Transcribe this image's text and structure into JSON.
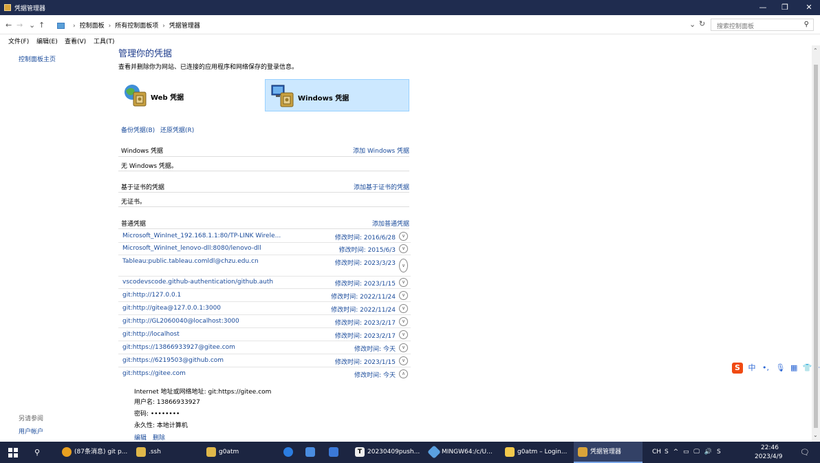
{
  "window": {
    "title": "凭据管理器",
    "minimize": "—",
    "maximize": "❐",
    "close": "✕"
  },
  "nav": {
    "back": "←",
    "forward": "→",
    "recent": "⌄",
    "up": "↑",
    "breadcrumbs": [
      "控制面板",
      "所有控制面板项",
      "凭据管理器"
    ],
    "refresh_chevron": "⌄",
    "refresh": "↻",
    "search_placeholder": "搜索控制面板"
  },
  "menu": {
    "file": "文件(F)",
    "edit": "编辑(E)",
    "view": "查看(V)",
    "tools": "工具(T)"
  },
  "sidebar": {
    "home": "控制面板主页",
    "see_also": "另请参阅",
    "user_accounts": "用户帐户"
  },
  "main": {
    "title": "管理你的凭据",
    "subtitle": "查看并删除你为网站、已连接的应用程序和网络保存的登录信息。",
    "web_vault": "Web 凭据",
    "windows_vault": "Windows 凭据",
    "backup": "备份凭据(B)",
    "restore": "还原凭据(R)",
    "windows_section": {
      "title": "Windows 凭据",
      "add": "添加 Windows 凭据",
      "empty": "无 Windows 凭据。"
    },
    "cert_section": {
      "title": "基于证书的凭据",
      "add": "添加基于证书的凭据",
      "empty": "无证书。"
    },
    "generic_section": {
      "title": "普通凭据",
      "add": "添加普通凭据"
    },
    "credentials": [
      {
        "name": "Microsoft_WinInet_192.168.1.1:80/TP-LINK Wirele...",
        "date": "修改时间: 2016/6/28"
      },
      {
        "name": "Microsoft_WinInet_lenovo-dll:8080/lenovo-dll",
        "date": "修改时间: 2015/6/3"
      },
      {
        "name": "Tableau:public.tableau.comldl@chzu.edu.cn",
        "date": "修改时间: 2023/3/23"
      },
      {
        "name": "vscodevscode.github-authentication/github.auth",
        "date": "修改时间: 2023/1/15"
      },
      {
        "name": "git:http://127.0.0.1",
        "date": "修改时间: 2022/11/24"
      },
      {
        "name": "git:http://gitea@127.0.0.1:3000",
        "date": "修改时间: 2022/11/24"
      },
      {
        "name": "git:http://GL2060040@localhost:3000",
        "date": "修改时间: 2023/2/17"
      },
      {
        "name": "git:http://localhost",
        "date": "修改时间: 2023/2/17"
      },
      {
        "name": "git:https://13866933927@gitee.com",
        "date": "修改时间: 今天"
      },
      {
        "name": "git:https://6219503@github.com",
        "date": "修改时间: 2023/1/15"
      },
      {
        "name": "git:https://gitee.com",
        "date": "修改时间: 今天"
      }
    ],
    "expanded": {
      "address": "Internet 地址或网络地址: git:https://gitee.com",
      "username": "用户名: 13866933927",
      "password": "密码: ••••••••",
      "persistence": "永久性: 本地计算机",
      "edit": "编辑",
      "delete": "删除"
    }
  },
  "ime": {
    "logo": "S",
    "mode": "中",
    "punct": "•,",
    "mic": "🎙",
    "keyboard": "▦",
    "skin": "👕",
    "grid": "⁘"
  },
  "taskbar": {
    "search": "⚲",
    "items": [
      {
        "label": "(87条消息) git p...",
        "color": "#e8a020"
      },
      {
        "label": ".ssh",
        "color": "#e0b84a"
      },
      {
        "label": "g0atm",
        "color": "#e0b84a"
      },
      {
        "label": "",
        "color": "#2b7de0"
      },
      {
        "label": "",
        "color": "#4a8de0"
      },
      {
        "label": "",
        "color": "#3b79d8"
      },
      {
        "label": "20230409push...",
        "color": "#eeeeee"
      },
      {
        "label": "MINGW64:/c/U...",
        "color": "#5aa0e0"
      },
      {
        "label": "g0atm – Login...",
        "color": "#f2c94c"
      },
      {
        "label": "凭据管理器",
        "color": "#d9a43a"
      }
    ],
    "tray_lang": "CH",
    "tray_icons": "S  ^  ▭  🖵  🔊  S",
    "time": "22:46",
    "date": "2023/4/9",
    "notify": "🗨"
  }
}
